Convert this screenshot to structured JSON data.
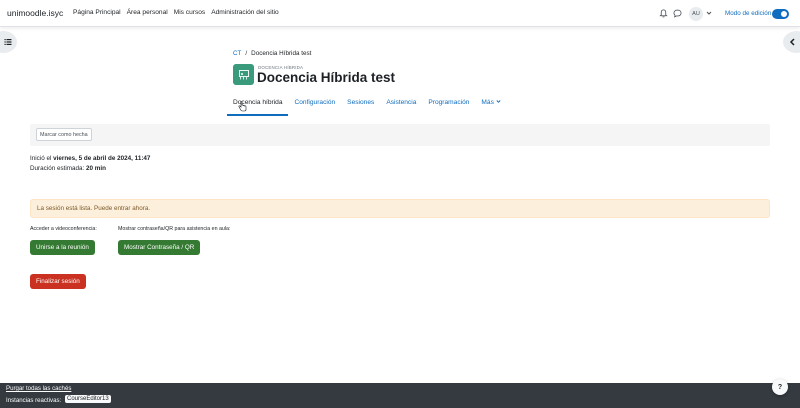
{
  "navbar": {
    "brand": "unimoodle.isyc",
    "links": [
      "Página Principal",
      "Área personal",
      "Mis cursos",
      "Administración del sitio"
    ],
    "avatar_initials": "AU",
    "edit_mode_label": "Modo de edición",
    "edit_mode_on": true
  },
  "icons": {
    "notifications": "bell-icon",
    "messages": "chat-icon",
    "user_menu": "chevron-down-icon",
    "left_drawer": "list-icon",
    "right_drawer": "chevron-left-icon",
    "activity": "classroom-icon"
  },
  "breadcrumb": {
    "course": "CT",
    "separator": "/",
    "current": "Docencia Híbrida test"
  },
  "header": {
    "activity_type": "DOCENCIA HÍBRIDA",
    "title": "Docencia Híbrida test"
  },
  "tabs": [
    {
      "label": "Docencia híbrida",
      "active": true
    },
    {
      "label": "Configuración",
      "active": false
    },
    {
      "label": "Sesiones",
      "active": false
    },
    {
      "label": "Asistencia",
      "active": false
    },
    {
      "label": "Programación",
      "active": false
    },
    {
      "label": "Más",
      "active": false
    }
  ],
  "completion": {
    "button": "Marcar como hecha"
  },
  "session": {
    "start_prefix": "Inició el",
    "start_value": "viernes, 5 de abril de 2024, 11:47",
    "duration_prefix": "Duración estimada:",
    "duration_value": "20 min"
  },
  "alert": "La sesión está lista. Puede entrar ahora.",
  "access": {
    "video_label": "Acceder a videoconferencia:",
    "video_button": "Unirse a la reunión",
    "qr_label": "Mostrar contraseña/QR para asistencia en aula:",
    "qr_button": "Mostrar Contraseña / QR",
    "finish_button": "Finalizar sesión"
  },
  "footer": {
    "purge_link": "Purgar todas las cachés",
    "instances_label": "Instancias reactivas:",
    "instances_badge": "CourseEditor13",
    "help": "?"
  },
  "colors": {
    "primary": "#0f6cbf",
    "success": "#357a32",
    "danger": "#ca3120",
    "activity_icon_bg": "#399b7b",
    "alert_bg": "#fcefdc",
    "footer_bg": "#343a40"
  }
}
